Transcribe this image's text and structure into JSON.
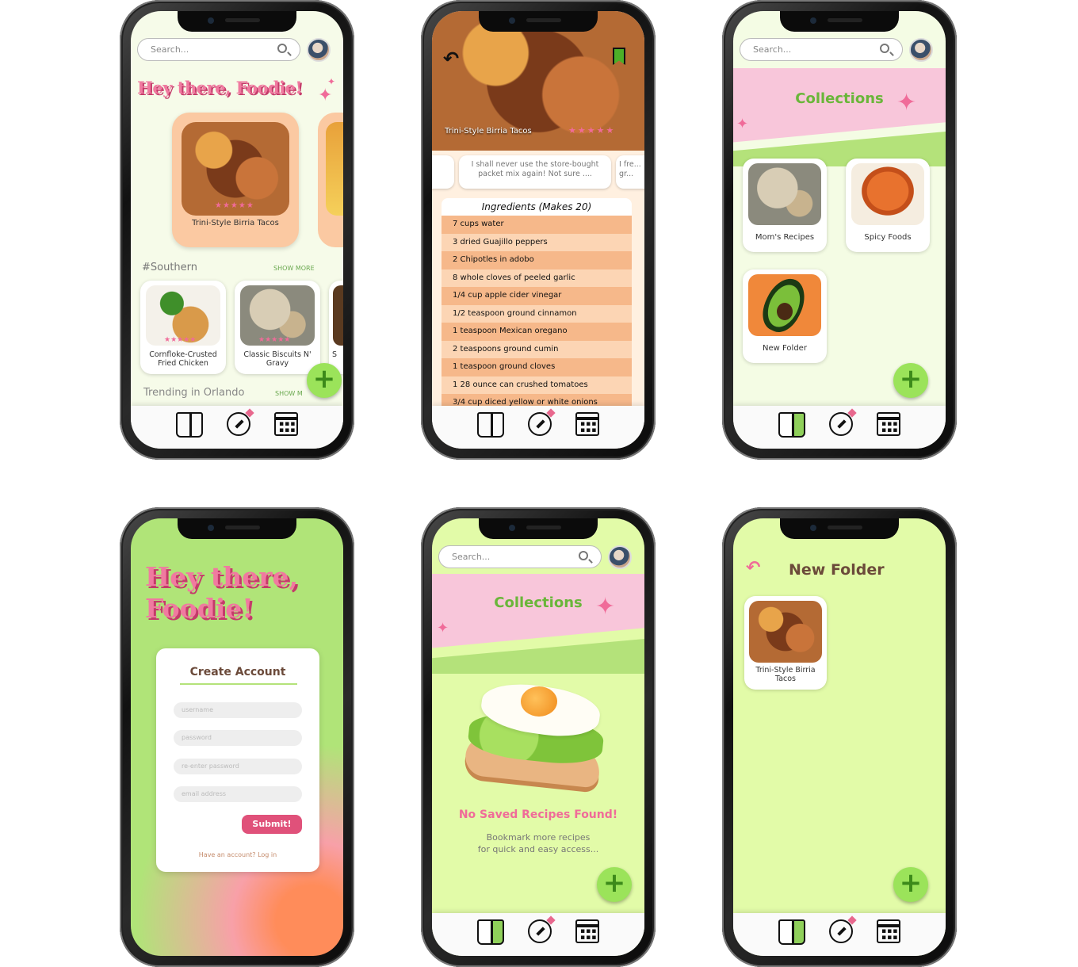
{
  "common": {
    "search_placeholder": "Search...",
    "fab_symbol": "+"
  },
  "home": {
    "greeting": "Hey there, Foodie!",
    "featured": {
      "name": "Trini-Style Birria Tacos",
      "stars": "★★★★★"
    },
    "section1": {
      "title": "#Southern",
      "show_more": "SHOW MORE",
      "items": [
        {
          "name": "Cornfloke-Crusted Fried Chicken",
          "stars": "★★★★★"
        },
        {
          "name": "Classic Biscuits N' Gravy",
          "stars": "★★★★★"
        },
        {
          "name": "S"
        }
      ]
    },
    "section2": {
      "title": "Trending in Orlando",
      "show_more": "SHOW M"
    }
  },
  "recipe": {
    "title": "Trini-Style Birria Tacos",
    "stars": "★★★★★",
    "reviews": [
      "I shall never use the store-bought packet mix again! Not sure ....",
      "I fre... gr..."
    ],
    "ingredients_title": "Ingredients (Makes 20)",
    "ingredients": [
      "7 cups water",
      "3 dried Guajillo peppers",
      "2 Chipotles in adobo",
      "8 whole cloves of peeled garlic",
      "1/4 cup apple cider vinegar",
      "1/2 teaspoon ground cinnamon",
      "1 teaspoon Mexican oregano",
      "2 teaspoons ground cumin",
      "1 teaspoon ground cloves",
      "1 28 ounce can crushed tomatoes",
      "3/4 cup diced yellow or white onions"
    ]
  },
  "collections": {
    "title": "Collections",
    "folders": [
      {
        "name": "Mom's Recipes"
      },
      {
        "name": "Spicy Foods"
      },
      {
        "name": "New Folder"
      }
    ]
  },
  "signup": {
    "greeting_line1": "Hey there,",
    "greeting_line2": "Foodie!",
    "card_title": "Create Account",
    "fields": [
      "username",
      "password",
      "re-enter password",
      "email address"
    ],
    "submit": "Submit!",
    "login_text": "Have an account? Log in"
  },
  "empty_collections": {
    "title": "Collections",
    "empty_title": "No Saved Recipes Found!",
    "empty_line1": "Bookmark more recipes",
    "empty_line2": "for quick and easy access..."
  },
  "new_folder": {
    "title": "New Folder",
    "items": [
      {
        "name": "Trini-Style Birria Tacos"
      }
    ]
  }
}
